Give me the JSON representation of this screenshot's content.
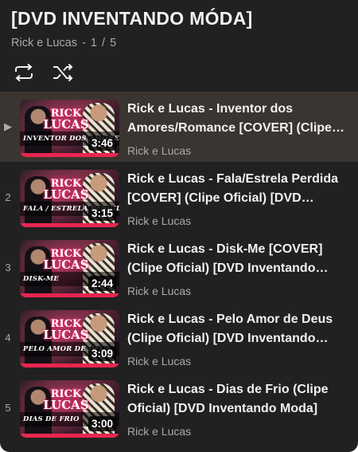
{
  "playlist": {
    "title": "[DVD INVENTANDO MÓDA]",
    "channel": "Rick e Lucas",
    "position": "1",
    "total": "5",
    "separator": "-",
    "of": "/"
  },
  "controls": {
    "loop_icon": "loop-icon",
    "shuffle_icon": "shuffle-icon"
  },
  "colors": {
    "background": "#212121",
    "active_row": "#3a3530",
    "accent": "#e8264f"
  },
  "items": [
    {
      "index": "▶",
      "title": "Rick e Lucas - Inventor dos Amores/Romance [COVER] (Clipe Oficial) [DVD Inventando Moda]",
      "channel": "Rick e Lucas",
      "duration": "3:46",
      "thumb_caption": "INVENTOR DOS AMORES / ROMANCE",
      "logo_top": "RICK",
      "logo_bottom": "LUCAS",
      "active": true
    },
    {
      "index": "2",
      "title": "Rick e Lucas - Fala/Estrela Perdida [COVER] (Clipe Oficial) [DVD Inventando Moda]",
      "channel": "Rick e Lucas",
      "duration": "3:15",
      "thumb_caption": "FALA / ESTRELA PERDIDA",
      "logo_top": "RICK",
      "logo_bottom": "LUCAS",
      "active": false
    },
    {
      "index": "3",
      "title": "Rick e Lucas - Disk-Me [COVER] (Clipe Oficial) [DVD Inventando Moda]",
      "channel": "Rick e Lucas",
      "duration": "2:44",
      "thumb_caption": "DISK-ME",
      "logo_top": "RICK",
      "logo_bottom": "LUCAS",
      "active": false
    },
    {
      "index": "4",
      "title": "Rick e Lucas - Pelo Amor de Deus (Clipe Oficial) [DVD Inventando Moda]",
      "channel": "Rick e Lucas",
      "duration": "3:09",
      "thumb_caption": "PELO AMOR DE DEUS",
      "logo_top": "RICK",
      "logo_bottom": "LUCAS",
      "active": false
    },
    {
      "index": "5",
      "title": "Rick e Lucas - Dias de Frio (Clipe Oficial) [DVD Inventando Moda]",
      "channel": "Rick e Lucas",
      "duration": "3:00",
      "thumb_caption": "DIAS DE FRIO",
      "logo_top": "RICK",
      "logo_bottom": "LUCAS",
      "active": false
    }
  ]
}
